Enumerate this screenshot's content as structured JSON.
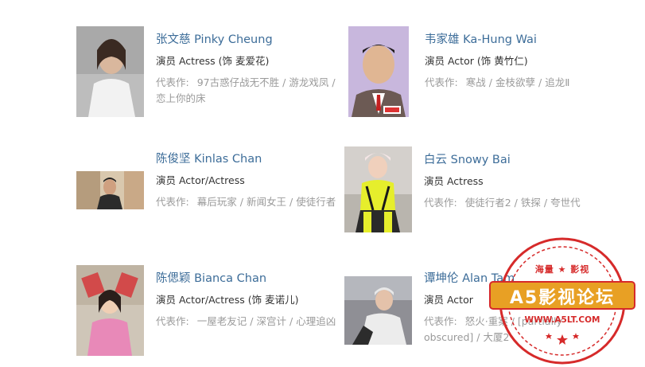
{
  "works_label": "代表作:",
  "people": [
    {
      "name": "张文慈 Pinky Cheung",
      "role": "演员 Actress (饰 麦爱花)",
      "works": [
        "97古惑仔战无不胜",
        "游龙戏凤",
        "恋上你的床"
      ]
    },
    {
      "name": "韦家雄 Ka-Hung Wai",
      "role": "演员 Actor (饰 黄竹仁)",
      "works": [
        "寒战",
        "金枝欲孽",
        "追龙Ⅱ"
      ]
    },
    {
      "name": "陈俊坚 Kinlas Chan",
      "role": "演员 Actor/Actress",
      "works": [
        "幕后玩家",
        "新闻女王",
        "使徒行者"
      ]
    },
    {
      "name": "白云 Snowy Bai",
      "role": "演员 Actress",
      "works": [
        "使徒行者2",
        "铁探",
        "夸世代"
      ]
    },
    {
      "name": "陈偲颖 Bianca Chan",
      "role": "演员 Actor/Actress (饰 麦诺儿)",
      "works": [
        "一屋老友记",
        "深宫计",
        "心理追凶"
      ]
    },
    {
      "name": "谭坤伦 Alan Tam",
      "role": "演员 Actor",
      "works": [
        "怒火·重案",
        "[partially obscured]",
        "大厦2"
      ]
    }
  ],
  "watermark": {
    "top_text": "海量 ★ 影视",
    "title": "A5影视论坛",
    "url": "WWW.A5LT.COM"
  }
}
